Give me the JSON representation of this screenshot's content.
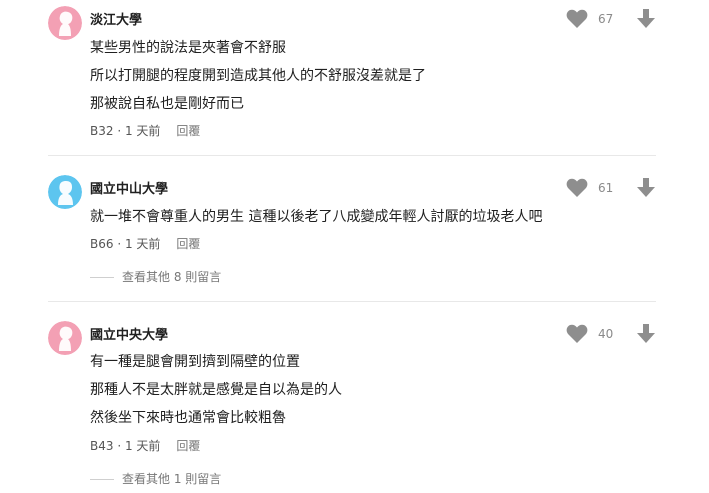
{
  "colors": {
    "pink": "#f3a0b4",
    "blue": "#5dc5ef",
    "icon": "#8e8e8e"
  },
  "comments": [
    {
      "school": "淡江大學",
      "avatar": "pink",
      "lines": [
        "某些男性的說法是夾著會不舒服",
        "所以打開腿的程度開到造成其他人的不舒服沒差就是了",
        "那被說自私也是剛好而已"
      ],
      "floor": "B32",
      "time": "1 天前",
      "reply": "回覆",
      "likes": "67"
    },
    {
      "school": "國立中山大學",
      "avatar": "blue",
      "lines": [
        "就一堆不會尊重人的男生 這種以後老了八成變成年輕人討厭的垃圾老人吧"
      ],
      "floor": "B66",
      "time": "1 天前",
      "reply": "回覆",
      "likes": "61",
      "more": "查看其他 8 則留言"
    },
    {
      "school": "國立中央大學",
      "avatar": "pink",
      "lines": [
        "有一種是腿會開到擠到隔壁的位置",
        "那種人不是太胖就是感覺是自以為是的人",
        "然後坐下來時也通常會比較粗魯"
      ],
      "floor": "B43",
      "time": "1 天前",
      "reply": "回覆",
      "likes": "40",
      "more": "查看其他 1 則留言"
    }
  ]
}
